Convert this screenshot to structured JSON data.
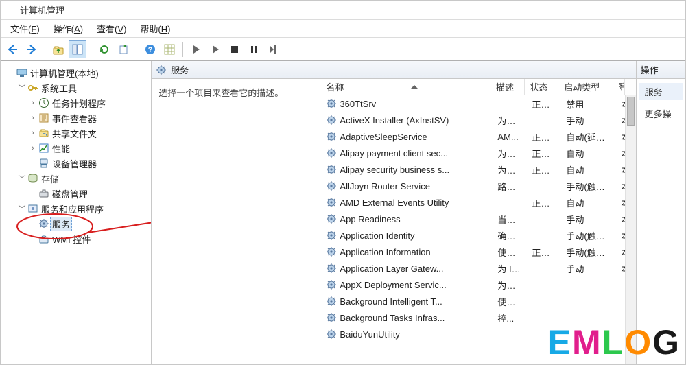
{
  "window": {
    "title": "计算机管理"
  },
  "menu": {
    "file": {
      "label": "文件",
      "hotkey": "F"
    },
    "action": {
      "label": "操作",
      "hotkey": "A"
    },
    "view": {
      "label": "查看",
      "hotkey": "V"
    },
    "help": {
      "label": "帮助",
      "hotkey": "H"
    }
  },
  "toolbar_icons": {
    "back": "back-arrow",
    "forward": "forward-arrow",
    "up": "up-folder",
    "show_tree": "show-tree",
    "refresh": "refresh",
    "export": "export",
    "help": "help",
    "grid": "grid",
    "play": "play",
    "play2": "play",
    "stop": "stop",
    "pause": "pause",
    "step": "step"
  },
  "tree": {
    "root": "计算机管理(本地)",
    "system_tools": "系统工具",
    "task_scheduler": "任务计划程序",
    "event_viewer": "事件查看器",
    "shared_folders": "共享文件夹",
    "performance": "性能",
    "device_manager": "设备管理器",
    "storage": "存储",
    "disk_management": "磁盘管理",
    "services_apps": "服务和应用程序",
    "services": "服务",
    "wmi_control": "WMI 控件"
  },
  "center": {
    "title": "服务",
    "desc_prompt": "选择一个项目来查看它的描述。",
    "columns": {
      "name": "名称",
      "desc": "描述",
      "status": "状态",
      "start": "启动类型",
      "logon": "登"
    }
  },
  "services": [
    {
      "name": "360TtSrv",
      "desc": "",
      "status": "正在...",
      "start": "禁用",
      "logon": "本"
    },
    {
      "name": "ActiveX Installer (AxInstSV)",
      "desc": "为从...",
      "status": "",
      "start": "手动",
      "logon": "本"
    },
    {
      "name": "AdaptiveSleepService",
      "desc": "AM...",
      "status": "正在...",
      "start": "自动(延迟...",
      "logon": "本"
    },
    {
      "name": "Alipay payment client sec...",
      "desc": "为支...",
      "status": "正在...",
      "start": "自动",
      "logon": "本"
    },
    {
      "name": "Alipay security business s...",
      "desc": "为支...",
      "status": "正在...",
      "start": "自动",
      "logon": "本"
    },
    {
      "name": "AllJoyn Router Service",
      "desc": "路由...",
      "status": "",
      "start": "手动(触发...",
      "logon": "本"
    },
    {
      "name": "AMD External Events Utility",
      "desc": "",
      "status": "正在...",
      "start": "自动",
      "logon": "本"
    },
    {
      "name": "App Readiness",
      "desc": "当用...",
      "status": "",
      "start": "手动",
      "logon": "本"
    },
    {
      "name": "Application Identity",
      "desc": "确定...",
      "status": "",
      "start": "手动(触发...",
      "logon": "本"
    },
    {
      "name": "Application Information",
      "desc": "使用...",
      "status": "正在...",
      "start": "手动(触发...",
      "logon": "本"
    },
    {
      "name": "Application Layer Gatew...",
      "desc": "为 In...",
      "status": "",
      "start": "手动",
      "logon": "本"
    },
    {
      "name": "AppX Deployment Servic...",
      "desc": "为部...",
      "status": "",
      "start": "",
      "logon": ""
    },
    {
      "name": "Background Intelligent T...",
      "desc": "使用...",
      "status": "",
      "start": "",
      "logon": ""
    },
    {
      "name": "Background Tasks Infras...",
      "desc": "控...",
      "status": "",
      "start": "",
      "logon": ""
    },
    {
      "name": "BaiduYunUtility",
      "desc": "",
      "status": "",
      "start": "",
      "logon": ""
    }
  ],
  "actions_panel": {
    "header": "操作",
    "group": "服务",
    "more": "更多操"
  },
  "watermark": "EMLOG"
}
